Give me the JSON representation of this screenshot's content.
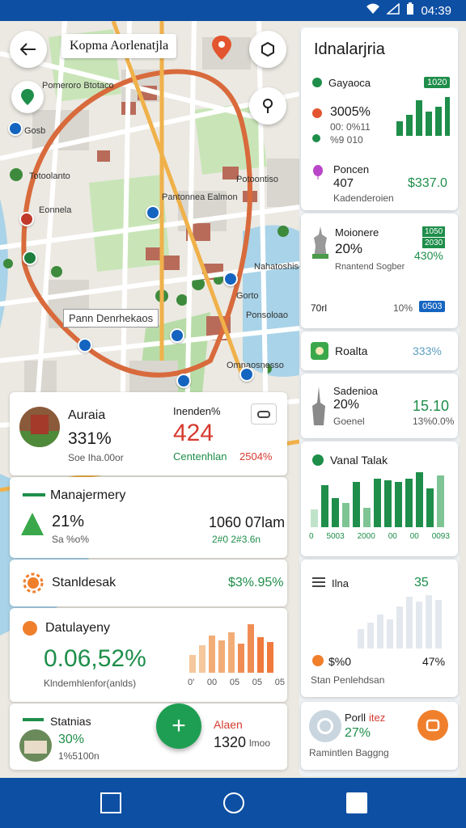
{
  "status_bar": {
    "time": "04:39"
  },
  "map": {
    "title": "Kopma Aorlenatjla",
    "labels": [
      "Pomeroro Btotaco",
      "Gosb",
      "Totoolanto",
      "Eonnela",
      "Pantonnea Ealmon",
      "Potoontiso",
      "Nahatoshiso",
      "Gorto",
      "Ponsoloao",
      "Omnaosnesso"
    ],
    "marker_label": "Pann Denrhekaos"
  },
  "cards": {
    "card1": {
      "name": "Auraia",
      "percent": "331%",
      "sub": "Soe Iha.00or",
      "label": "Inenden%",
      "big_value": "424",
      "green_label": "Centenhlan",
      "red_value": "2504%"
    },
    "card2": {
      "name": "Manajermery",
      "percent": "21%",
      "sub": "Sa %o%",
      "value": "1060 07lam",
      "sub_value": "2#0 2#3.6n"
    },
    "card3": {
      "name": "Stanldesak",
      "value": "$3%.95%"
    },
    "card4": {
      "name": "Datulayeny",
      "big_value": "0.06,52%",
      "sub": "Klndemhlenfor(anlds)",
      "axis": [
        "0'",
        "00",
        "05",
        "05",
        "05"
      ]
    },
    "card5": {
      "name": "Statnias",
      "percent": "30%",
      "sub": "1%5100n",
      "label": "Alaen",
      "value": "1320",
      "unit": "lmoo"
    }
  },
  "panel": {
    "title": "Idnalarjria",
    "sec1": {
      "name": "Gayaoca",
      "badge": "1020",
      "pct": "3005%",
      "l1": "00: 0%11",
      "l2": "%9 010"
    },
    "sec2": {
      "name": "Poncen",
      "value": "407",
      "money": "$337.0",
      "sub": "Kadenderoien"
    },
    "sec3": {
      "name": "Moionere",
      "pct": "20%",
      "b1": "1050",
      "b2": "2030",
      "pct2": "430%",
      "sub": "Rnantend Sogber",
      "l": "70rl",
      "r": "10%",
      "badge": "0503"
    },
    "sec4": {
      "name": "Roalta",
      "pct": "333%"
    },
    "sec5": {
      "name": "Sadenioa",
      "pct": "20%",
      "sub": "Goenel",
      "value": "15.10",
      "sub2": "13%0.0%"
    },
    "sec6": {
      "name": "Vanal Talak",
      "axis": [
        "0",
        "5003",
        "2000",
        "00",
        "00",
        "0093"
      ]
    },
    "sec7": {
      "name": "Ilna",
      "value": "35",
      "money": "$%0",
      "pct": "47%",
      "sub": "Stan Penlehdsan"
    },
    "sec8": {
      "name": "Porll",
      "tag": "itez",
      "pct": "27%",
      "sub": "Ramintlen Baggng"
    }
  },
  "colors": {
    "green": "#1e8e4a",
    "red": "#d63a2f",
    "blue": "#0d4fa3",
    "orange": "#f07f2c"
  }
}
